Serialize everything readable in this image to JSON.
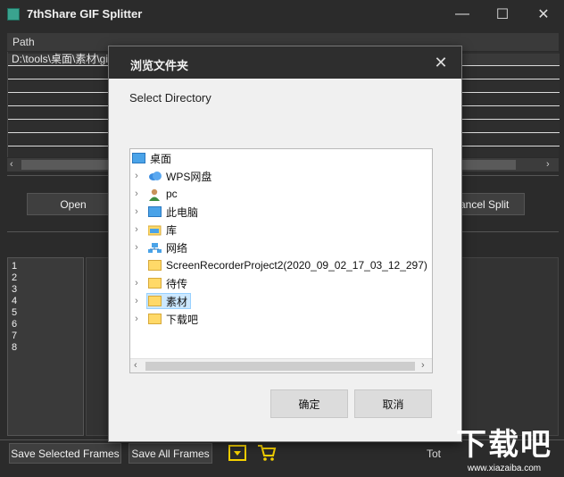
{
  "window": {
    "title": "7thShare GIF Splitter",
    "minimize_glyph": "—",
    "maximize_glyph": "☐",
    "close_glyph": "✕"
  },
  "path_header": "Path",
  "file_list": {
    "rows": [
      "D:\\tools\\桌面\\素材\\gi",
      "",
      "",
      "",
      "",
      "",
      "",
      ""
    ]
  },
  "buttons": {
    "open": "Open",
    "cancel_split": "ancel Split",
    "save_selected": "Save Selected Frames",
    "save_all": "Save All Frames"
  },
  "frames": [
    "1",
    "2",
    "3",
    "4",
    "5",
    "6",
    "7",
    "8"
  ],
  "total_label": "Tot",
  "dialog": {
    "title": "浏览文件夹",
    "subtitle": "Select Directory",
    "ok": "确定",
    "cancel": "取消",
    "close_glyph": "✕",
    "tree": [
      {
        "label": "桌面",
        "icon": "desktop-icon",
        "chevron": ""
      },
      {
        "label": "WPS网盘",
        "icon": "cloud-icon",
        "chevron": "›"
      },
      {
        "label": "pc",
        "icon": "user-icon",
        "chevron": "›"
      },
      {
        "label": "此电脑",
        "icon": "computer-icon",
        "chevron": "›"
      },
      {
        "label": "库",
        "icon": "library-icon",
        "chevron": "›"
      },
      {
        "label": "网络",
        "icon": "network-icon",
        "chevron": "›"
      },
      {
        "label": "ScreenRecorderProject2(2020_09_02_17_03_12_297)",
        "icon": "folder-icon",
        "chevron": ""
      },
      {
        "label": "待传",
        "icon": "folder-icon",
        "chevron": "›"
      },
      {
        "label": "素材",
        "icon": "folder-icon",
        "chevron": "›",
        "selected": true
      },
      {
        "label": "下载吧",
        "icon": "folder-icon",
        "chevron": "›"
      }
    ]
  },
  "watermark": {
    "logo_text": "下载吧",
    "url": "www.xiazaiba.com"
  },
  "colors": {
    "dark_bg": "#2b2b2b",
    "dialog_bg": "#f0f0f0",
    "selected_bg": "#cce8ff",
    "folder_yellow": "#ffd968",
    "accent_yellow": "#f5d000"
  }
}
